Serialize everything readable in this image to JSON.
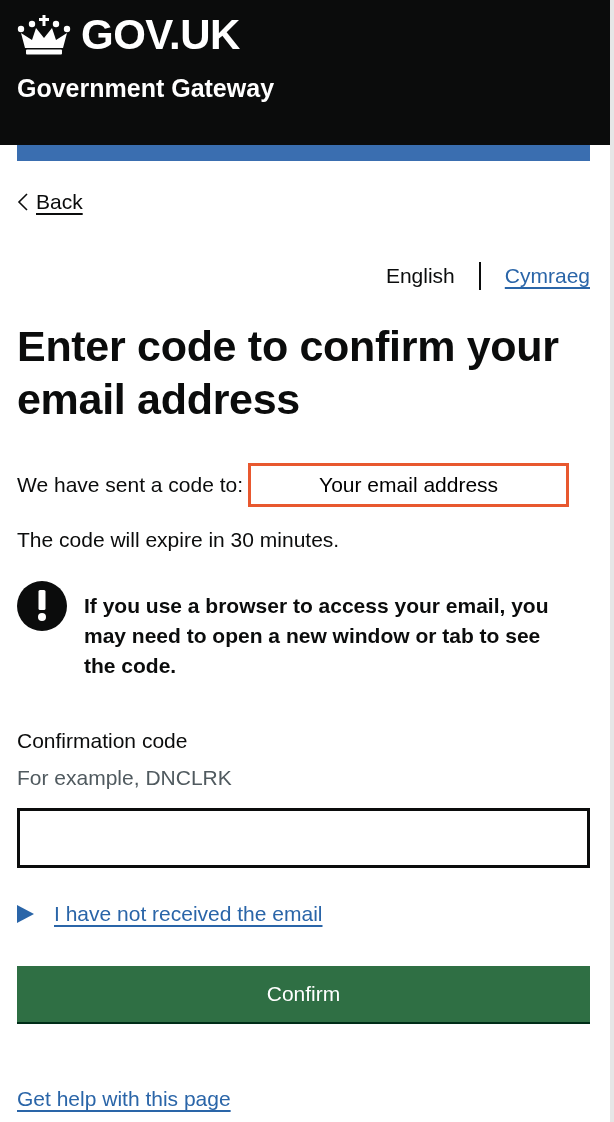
{
  "header": {
    "logo_text": "GOV.UK",
    "service_name": "Government Gateway"
  },
  "back_link": {
    "label": "Back"
  },
  "language_switcher": [
    {
      "label": "English",
      "selected": true
    },
    {
      "label": "Cymraeg",
      "selected": false
    }
  ],
  "heading": "Enter code to confirm your email address",
  "sent_to": {
    "text": "We have sent a code to:",
    "email": "Your email address"
  },
  "expiry_text": "The code will expire in 30 minutes.",
  "warning_text": "If you use a browser to access your email, you may need to open a new window or tab to see the code.",
  "code_field": {
    "label": "Confirmation code",
    "hint": "For example, DNCLRK"
  },
  "details": {
    "summary": "I have not received the email",
    "expanded": false
  },
  "confirm_button": {
    "label": "Confirm"
  },
  "help_link": {
    "label": "Get help with this page"
  }
}
